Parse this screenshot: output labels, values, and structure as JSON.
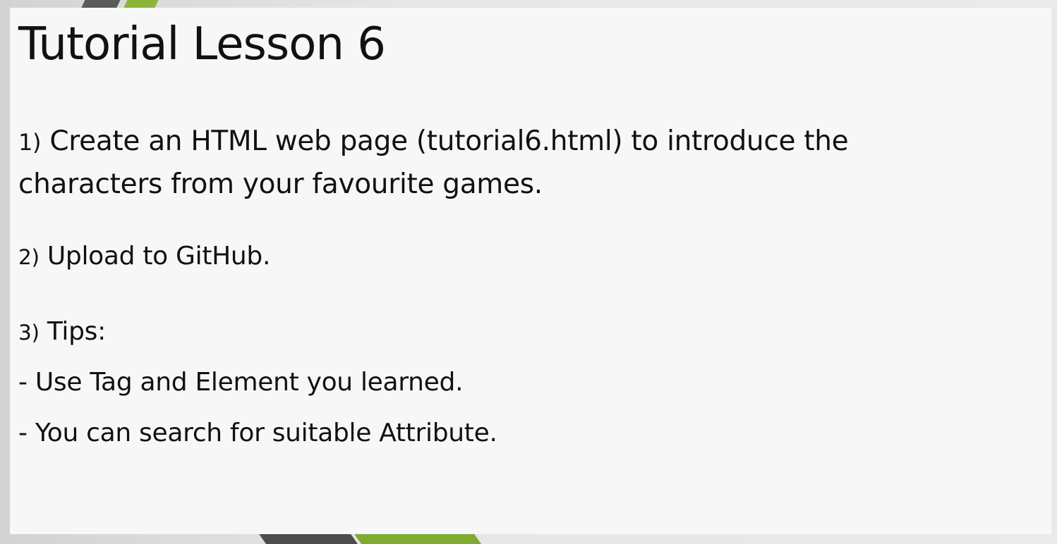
{
  "slide": {
    "title": "Tutorial Lesson 6",
    "items": [
      {
        "number": "1)",
        "text": " Create an HTML web page (tutorial6.html) to introduce the characters from your favourite games."
      },
      {
        "number": "2)",
        "text": " Upload to GitHub."
      },
      {
        "number": "3)",
        "text": " Tips:"
      }
    ],
    "tips": [
      "- Use Tag and Element you learned.",
      "- You can search for suitable Attribute."
    ]
  },
  "colors": {
    "accent_green": "#8cb43a",
    "accent_dark": "#5a5c5c",
    "slide_background": "#f7f7f7",
    "text": "#111111"
  }
}
